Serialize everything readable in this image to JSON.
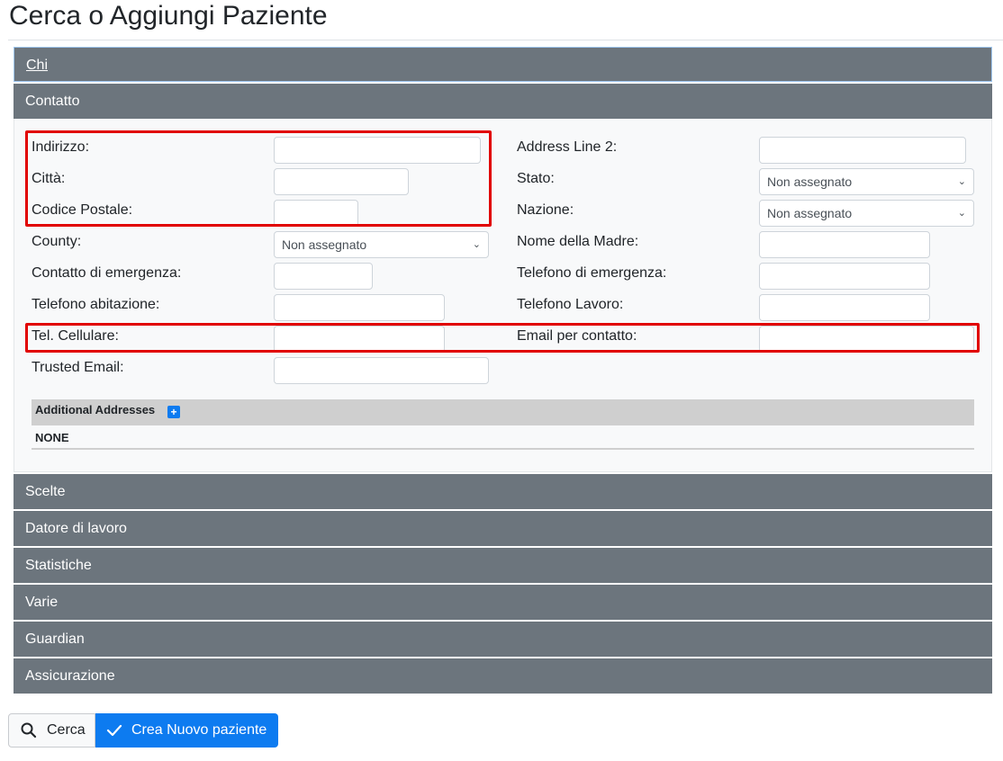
{
  "page": {
    "title": "Cerca o Aggiungi Paziente"
  },
  "sections": {
    "chi": "Chi",
    "contatto": "Contatto",
    "scelte": "Scelte",
    "datore": "Datore di lavoro",
    "statistiche": "Statistiche",
    "varie": "Varie",
    "guardian": "Guardian",
    "assicurazione": "Assicurazione"
  },
  "contact": {
    "indirizzo": {
      "label": "Indirizzo:",
      "value": ""
    },
    "citta": {
      "label": "Città:",
      "value": ""
    },
    "cap": {
      "label": "Codice Postale:",
      "value": ""
    },
    "county": {
      "label": "County:",
      "value": "Non assegnato"
    },
    "emerg_contact": {
      "label": "Contatto di emergenza:",
      "value": ""
    },
    "home_phone": {
      "label": "Telefono abitazione:",
      "value": ""
    },
    "cell_phone": {
      "label": "Tel. Cellulare:",
      "value": ""
    },
    "trusted_email": {
      "label": "Trusted Email:",
      "value": ""
    },
    "address2": {
      "label": "Address Line 2:",
      "value": ""
    },
    "stato": {
      "label": "Stato:",
      "value": "Non assegnato"
    },
    "nazione": {
      "label": "Nazione:",
      "value": "Non assegnato"
    },
    "madre": {
      "label": "Nome della Madre:",
      "value": ""
    },
    "emerg_phone": {
      "label": "Telefono di emergenza:",
      "value": ""
    },
    "work_phone": {
      "label": "Telefono Lavoro:",
      "value": ""
    },
    "email": {
      "label": "Email per contatto:",
      "value": ""
    }
  },
  "additional_addresses": {
    "title": "Additional Addresses",
    "add_symbol": "+",
    "empty": "NONE"
  },
  "buttons": {
    "search": "Cerca",
    "create": "Crea Nuovo paziente"
  },
  "icons": {
    "search": "search-icon",
    "check": "check-icon",
    "chevron": "chevron-down-icon",
    "plus": "plus-icon"
  },
  "colors": {
    "header_gray": "#6c757d",
    "primary": "#0d7bf0",
    "highlight": "#e10000"
  }
}
